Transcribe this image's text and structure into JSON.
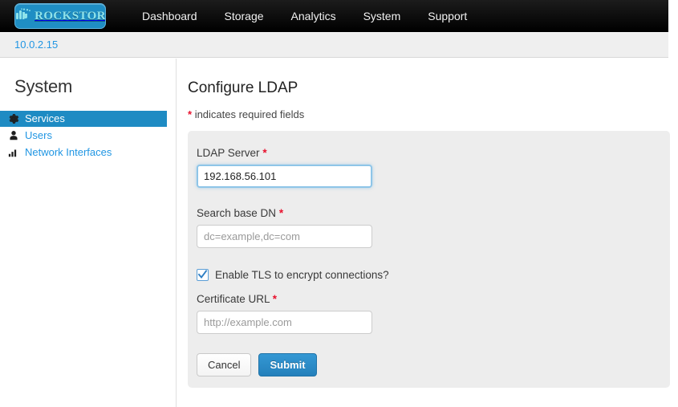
{
  "navbar": {
    "brand": {
      "text": "ROCKSTOR",
      "icon": "rockstor-hand-logo",
      "bg_color": "#1f8ec4",
      "text_color": "#8fe3ea"
    },
    "links": [
      {
        "label": "Dashboard"
      },
      {
        "label": "Storage"
      },
      {
        "label": "Analytics"
      },
      {
        "label": "System"
      },
      {
        "label": "Support"
      }
    ],
    "bg_color": "#000000"
  },
  "breadcrumb": {
    "label": "10.0.2.15",
    "color": "#2196e3"
  },
  "sidebar": {
    "title": "System",
    "items": [
      {
        "label": "Services",
        "icon": "gear-icon",
        "active": true
      },
      {
        "label": "Users",
        "icon": "user-icon",
        "active": false
      },
      {
        "label": "Network Interfaces",
        "icon": "signal-bars-icon",
        "active": false
      }
    ],
    "active_bg_color": "#1e8bc3",
    "link_color": "#2196e3"
  },
  "main": {
    "title": "Configure LDAP",
    "required_note_asterisk": "*",
    "required_note": "indicates required fields",
    "asterisk_color": "#e8112d",
    "panel_bg_color": "#ededed",
    "form": {
      "fields": [
        {
          "label": "LDAP Server",
          "required": true,
          "value": "192.168.56.101",
          "placeholder": "",
          "focused": true
        },
        {
          "label": "Search base DN",
          "required": true,
          "value": "",
          "placeholder": "dc=example,dc=com",
          "focused": false
        }
      ],
      "checkbox": {
        "label": "Enable TLS to encrypt connections?",
        "checked": true
      },
      "cert_field": {
        "label": "Certificate URL",
        "required": true,
        "value": "",
        "placeholder": "http://example.com",
        "focused": false
      },
      "buttons": {
        "cancel_label": "Cancel",
        "submit_label": "Submit",
        "submit_color": "#2480bb"
      }
    }
  }
}
